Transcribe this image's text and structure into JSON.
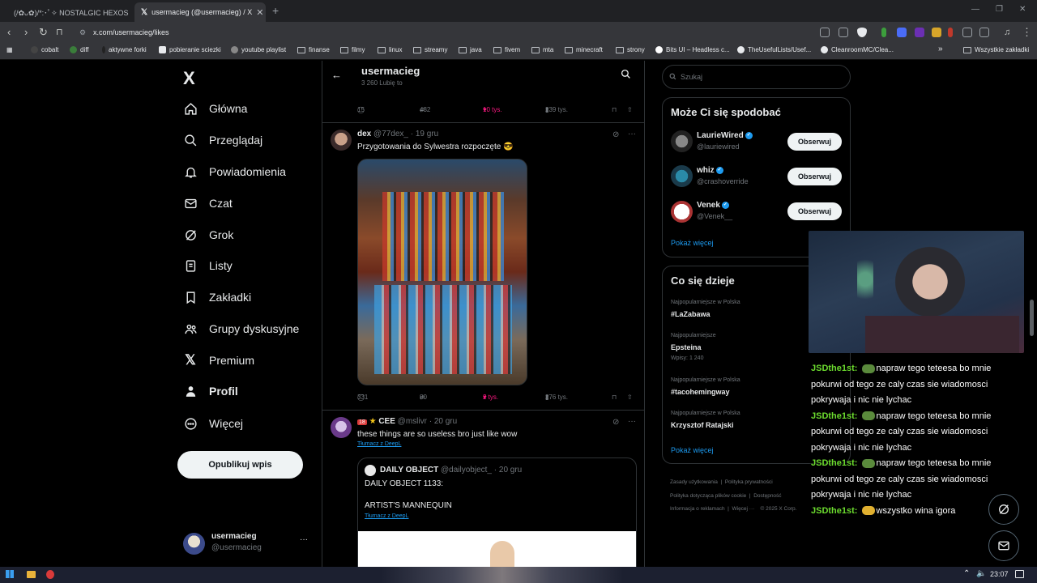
{
  "browser": {
    "tabs": [
      {
        "title": "(/✿ᴗ✿)/*:･ﾟ✧ NOSTALGIC HEXOS"
      },
      {
        "title": "usermacieg (@usermacieg) / X"
      }
    ],
    "new_tab": "+",
    "url": "x.com/usermacieg/likes",
    "bookmarks": [
      "cobalt",
      "diff",
      "aktywne forki",
      "pobieranie sciezki",
      "youtube playlist",
      "finanse",
      "filmy",
      "linux",
      "streamy",
      "java",
      "fivem",
      "mta",
      "minecraft",
      "strony",
      "Bits UI – Headless c...",
      "TheUsefulLists/Usef...",
      "CleanroomMC/Clea...",
      "»",
      "Wszystkie zakładki"
    ]
  },
  "sidebar": {
    "logo": "X",
    "items": [
      {
        "label": "Główna",
        "icon": "home-icon"
      },
      {
        "label": "Przeglądaj",
        "icon": "search-icon"
      },
      {
        "label": "Powiadomienia",
        "icon": "bell-icon"
      },
      {
        "label": "Czat",
        "icon": "mail-icon"
      },
      {
        "label": "Grok",
        "icon": "grok-icon"
      },
      {
        "label": "Listy",
        "icon": "list-icon"
      },
      {
        "label": "Zakładki",
        "icon": "bookmark-icon"
      },
      {
        "label": "Grupy dyskusyjne",
        "icon": "people-icon"
      },
      {
        "label": "Premium",
        "icon": "x-logo-icon"
      },
      {
        "label": "Profil",
        "icon": "person-icon"
      },
      {
        "label": "Więcej",
        "icon": "more-circle-icon"
      }
    ],
    "post_button": "Opublikuj wpis",
    "account": {
      "name": "usermacieg",
      "handle": "@usermacieg",
      "more": "···"
    }
  },
  "header": {
    "name": "usermacieg",
    "subtitle": "3 260 Lubię to"
  },
  "top_actions": {
    "replies": "15",
    "reposts": "432",
    "likes": "10 tys.",
    "views": "239 tys."
  },
  "posts": [
    {
      "name": "dex",
      "handle": "@77dex_",
      "date": "· 19 gru",
      "text": "Przygotowania do Sylwestra rozpoczęte 😎",
      "replies": "331",
      "reposts": "80",
      "likes": "2 tys.",
      "views": "276 tys."
    },
    {
      "name": "CEE",
      "badge": "18",
      "handle": "@mslivr",
      "date": "· 20 gru",
      "text": "these things are so useless bro just like wow",
      "translate": "Tłumacz z DeepL",
      "quote": {
        "name": "DAILY OBJECT",
        "handle": "@dailyobject_",
        "date": "· 20 gru",
        "line1": "DAILY OBJECT 1133:",
        "line2": "ARTIST'S MANNEQUIN",
        "translate": "Tłumacz z DeepL"
      }
    }
  ],
  "right": {
    "search_placeholder": "Szukaj",
    "suggestions_title": "Może Ci się spodobać",
    "suggestions": [
      {
        "name": "LaurieWired",
        "handle": "@lauriewired",
        "button": "Obserwuj"
      },
      {
        "name": "whiz",
        "handle": "@crashoverride",
        "button": "Obserwuj"
      },
      {
        "name": "Venek",
        "handle": "@Venek__",
        "button": "Obserwuj"
      }
    ],
    "show_more": "Pokaż więcej",
    "trends_title": "Co się dzieje",
    "trends": [
      {
        "category": "Najpopularniejsze w Polska",
        "name": "#LaZabawa",
        "meta": ""
      },
      {
        "category": "Najpopularniejsze",
        "name": "Epsteina",
        "meta": "Wpisy: 1 240"
      },
      {
        "category": "Najpopularniejsze w Polska",
        "name": "#tacohemingway",
        "meta": ""
      },
      {
        "category": "Najpopularniejsze w Polska",
        "name": "Krzysztof Ratajski",
        "meta": ""
      }
    ],
    "trends_more": "Pokaż więcej",
    "footer": {
      "l1a": "Zasady użytkowania",
      "l1b": "Polityka prywatności",
      "l2a": "Polityka dotycząca plików cookie",
      "l2b": "Dostępność",
      "l3a": "Informacja o reklamach",
      "l3b": "Więcej ···",
      "l3c": "© 2025 X Corp."
    }
  },
  "chat": [
    {
      "user": "JSDthe1st:",
      "text": "napraw tego teteesa bo mnie pokurwi od tego ze caly czas sie wiadomosci pokrywaja i nic nie lychac"
    },
    {
      "user": "JSDthe1st:",
      "text": "napraw tego teteesa bo mnie pokurwi od tego ze caly czas sie wiadomosci pokrywaja i nic nie lychac"
    },
    {
      "user": "JSDthe1st:",
      "text": "napraw tego teteesa bo mnie pokurwi od tego ze caly czas sie wiadomosci pokrywaja i nic nie lychac"
    },
    {
      "user": "JSDthe1st:",
      "text": "wszystko wina igora"
    }
  ],
  "taskbar": {
    "time": "23:07"
  },
  "colors": {
    "accent": "#1d9bf0",
    "like": "#f91880",
    "chat_name": "#6cdc2e"
  }
}
